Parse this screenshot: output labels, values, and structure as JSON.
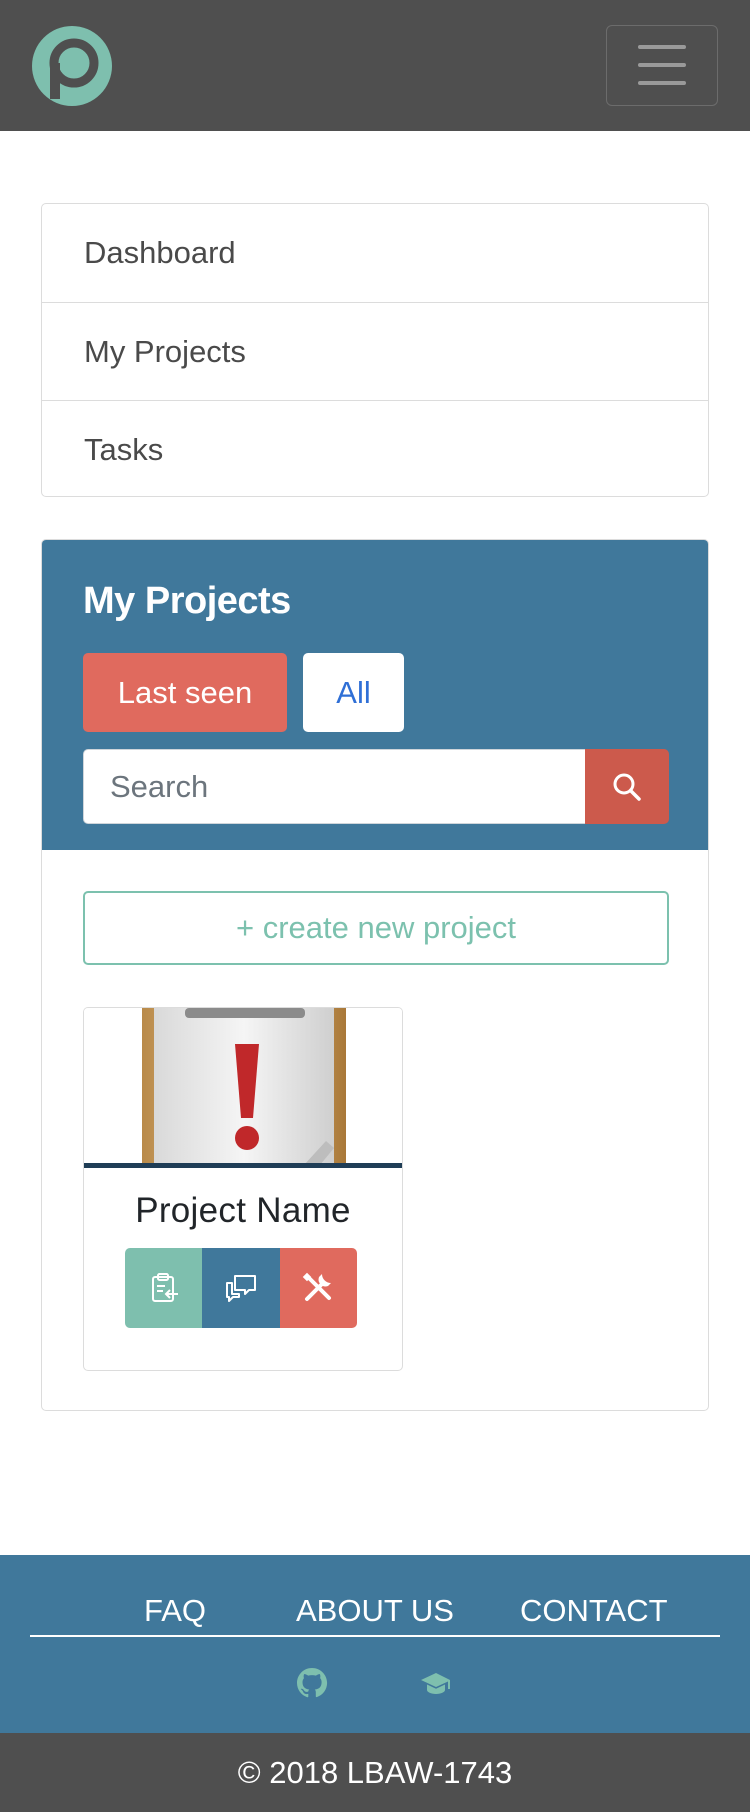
{
  "header": {
    "logo_icon": "p-logo-icon",
    "menu_icon": "hamburger-menu-icon"
  },
  "sidebar": {
    "items": [
      {
        "label": "Dashboard"
      },
      {
        "label": "My Projects"
      },
      {
        "label": "Tasks"
      }
    ]
  },
  "projects": {
    "title": "My Projects",
    "filters": {
      "last_seen": "Last seen",
      "all": "All"
    },
    "search": {
      "placeholder": "Search",
      "icon": "search-icon"
    },
    "create_label": "+ create new project",
    "cards": [
      {
        "name": "Project Name",
        "image_icon": "clipboard-exclamation-icon",
        "actions": [
          "clipboard-enter-icon",
          "chat-bubbles-icon",
          "tools-icon"
        ]
      }
    ]
  },
  "footer": {
    "links": [
      "FAQ",
      "ABOUT US",
      "CONTACT"
    ],
    "icons": [
      "github-icon",
      "graduation-cap-icon"
    ],
    "copyright": "© 2018 LBAW-1743"
  },
  "colors": {
    "navbar": "#4f4f4f",
    "primary_blue": "#40789b",
    "accent_red": "#e06a5e",
    "accent_teal": "#7ebfae",
    "link_blue": "#2f6fd6"
  }
}
